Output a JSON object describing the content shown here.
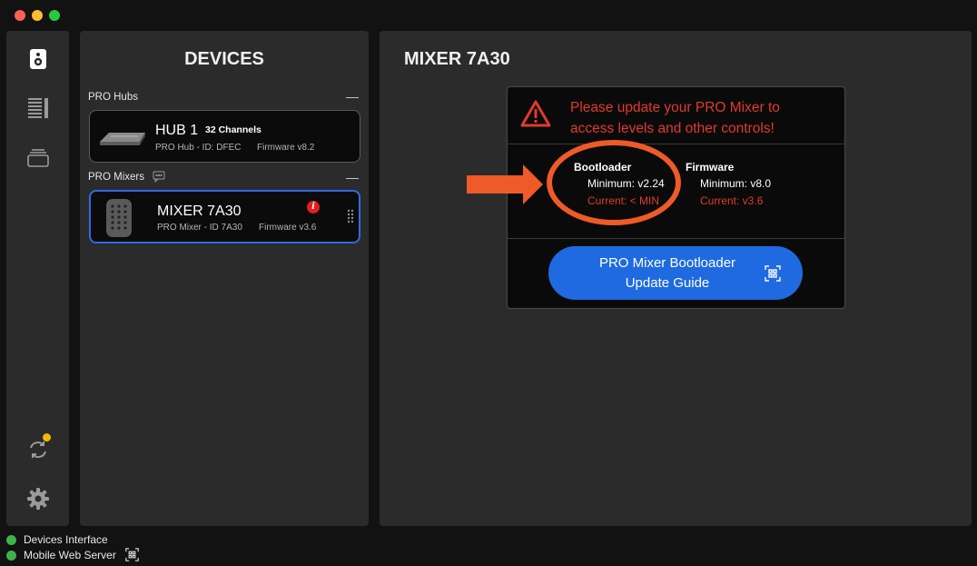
{
  "sidebar": {
    "icons": [
      "speaker-icon",
      "channel-list-icon",
      "stack-icon",
      "sync-icon",
      "gear-icon"
    ],
    "colors": {
      "notification_dot": "#f5b80a"
    }
  },
  "devices": {
    "title": "DEVICES",
    "hubs_section": {
      "label": "PRO Hubs",
      "collapse": "—"
    },
    "hub": {
      "name": "HUB 1",
      "channels": "32 Channels",
      "info": "PRO Hub - ID: DFEC",
      "firmware": "Firmware v8.2"
    },
    "mixers_section": {
      "label": "PRO Mixers",
      "collapse": "—"
    },
    "mixer": {
      "name": "MIXER 7A30",
      "info": "PRO Mixer - ID 7A30",
      "firmware": "Firmware v3.6",
      "alert": "i"
    }
  },
  "detail": {
    "title": "MIXER 7A30",
    "warning": {
      "line1": "Please update your PRO Mixer to",
      "line2": "access levels and other controls!"
    },
    "bootloader": {
      "heading": "Bootloader",
      "minimum": "Minimum: v2.24",
      "current": "Current: < MIN"
    },
    "firmware": {
      "heading": "Firmware",
      "minimum": "Minimum: v8.0",
      "current": "Current: v3.6"
    },
    "button": {
      "line1": "PRO Mixer Bootloader",
      "line2": "Update Guide"
    }
  },
  "status": {
    "items": [
      {
        "label": "Devices Interface"
      },
      {
        "label": "Mobile Web Server"
      }
    ]
  },
  "colors": {
    "accent_blue": "#1f6ae0",
    "alert_red": "#e03a2f",
    "annotation_orange": "#ee5a28",
    "status_green": "#3cb44b"
  }
}
